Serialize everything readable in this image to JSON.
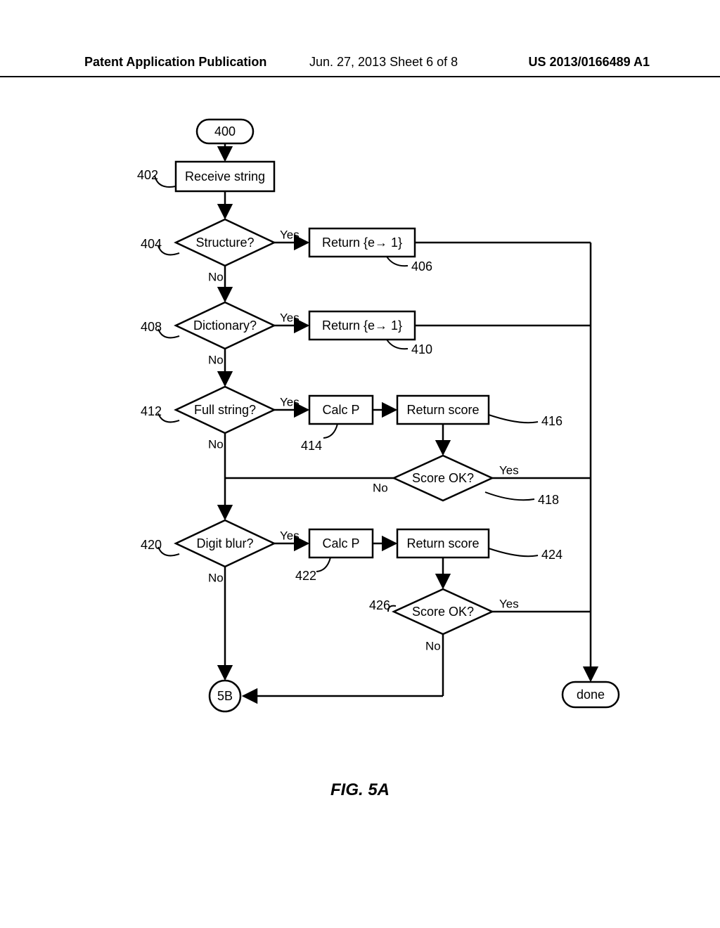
{
  "header": {
    "left": "Patent Application Publication",
    "mid": "Jun. 27, 2013  Sheet 6 of 8",
    "right": "US 2013/0166489 A1"
  },
  "figure_title": "FIG. 5A",
  "nodes": {
    "n400": "400",
    "n402": "Receive string",
    "n404": "Structure?",
    "n406": "Return {e→ 1}",
    "n408": "Dictionary?",
    "n410": "Return {e→ 1}",
    "n412": "Full string?",
    "n414": "Calc P",
    "n416": "Return score",
    "n418": "Score OK?",
    "n420": "Digit blur?",
    "n422": "Calc P",
    "n424": "Return score",
    "n426": "Score OK?",
    "n5b": "5B",
    "ndone": "done"
  },
  "refs": {
    "r402": "402",
    "r404": "404",
    "r406": "406",
    "r408": "408",
    "r410": "410",
    "r412": "412",
    "r414": "414",
    "r416": "416",
    "r418": "418",
    "r420": "420",
    "r422": "422",
    "r424": "424",
    "r426": "426"
  },
  "labels": {
    "yes": "Yes",
    "no": "No"
  }
}
